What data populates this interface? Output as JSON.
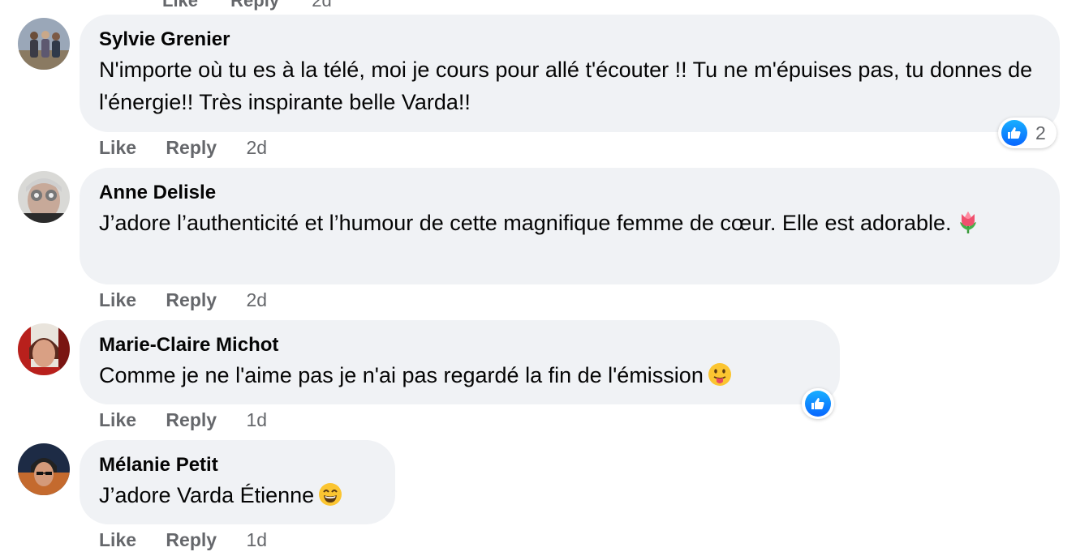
{
  "top_actions": {
    "like": "Like",
    "reply": "Reply",
    "time": "2d"
  },
  "comments": [
    {
      "author": "Sylvie Grenier",
      "text": "N'importe où tu es à la télé, moi je cours pour allé t'écouter !! Tu ne m'épuises pas, tu donnes de l'énergie!! Très inspirante belle Varda!!",
      "like": "Like",
      "reply": "Reply",
      "time": "2d",
      "reaction_count": "2",
      "reaction_icon": "like-icon"
    },
    {
      "author": "Anne Delisle",
      "text": "J’adore l’authenticité et l’humour de cette magnifique femme de cœur. Elle est adorable.",
      "emoji": "tulip-emoji",
      "like": "Like",
      "reply": "Reply",
      "time": "2d"
    },
    {
      "author": "Marie-Claire Michot",
      "text": "Comme je ne l'aime pas je n'ai pas regardé la fin de l'émission",
      "emoji": "tongue-out-emoji",
      "like": "Like",
      "reply": "Reply",
      "time": "1d",
      "reaction_icon": "like-icon"
    },
    {
      "author": "Mélanie Petit",
      "text": "J’adore Varda Étienne",
      "emoji": "grinning-emoji",
      "like": "Like",
      "reply": "Reply",
      "time": "1d"
    }
  ],
  "colors": {
    "bubble": "#f0f2f5",
    "secondary_text": "#65676b",
    "like_blue": "#0866ff"
  }
}
